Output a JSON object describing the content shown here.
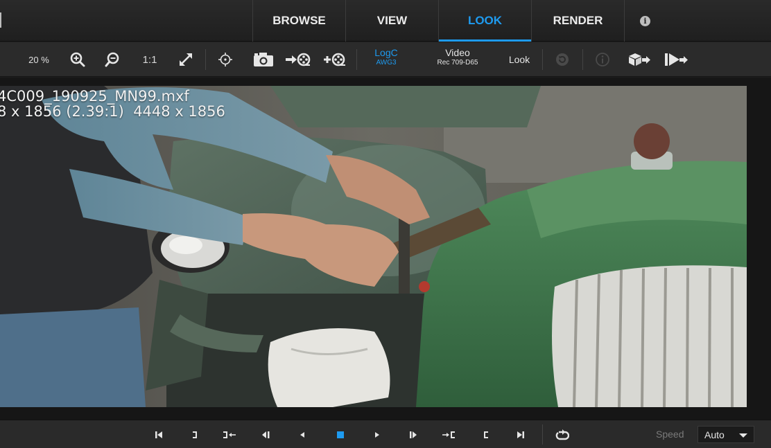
{
  "tabs": [
    {
      "label": "BROWSE",
      "active": false
    },
    {
      "label": "VIEW",
      "active": false
    },
    {
      "label": "LOOK",
      "active": true
    },
    {
      "label": "RENDER",
      "active": false
    }
  ],
  "info_tab": {
    "icon": "info-icon",
    "glyph": "i"
  },
  "toolbar": {
    "zoom_percent": "20 %",
    "one_to_one": "1:1",
    "input_colorspace": {
      "main": "LogC",
      "sub": "AWG3"
    },
    "output_colorspace": {
      "main": "Video",
      "sub": "Rec 709-D65"
    },
    "look_label": "Look",
    "icons": [
      "zoom-in-icon",
      "zoom-out-icon",
      "fit-expand-icon",
      "crosshair-icon",
      "camera-icon",
      "reel-import-icon",
      "reel-add-icon",
      "reset-look-icon",
      "info-icon",
      "export-box-icon",
      "export-cdl-icon"
    ]
  },
  "viewer": {
    "filename": "4C009_190925_MN99.mxf",
    "resolution": "8 x 1856 (2.39:1)  4448 x 1856"
  },
  "transport": {
    "icons": [
      "go-to-start-icon",
      "mark-out-icon",
      "go-to-out-icon",
      "step-back-icon",
      "play-reverse-icon",
      "stop-icon",
      "play-forward-icon",
      "step-forward-icon",
      "go-to-in-icon",
      "mark-in-icon",
      "go-to-end-icon",
      "loop-icon"
    ],
    "speed_label": "Speed",
    "speed_value": "Auto"
  },
  "colors": {
    "accent": "#1e9bf0",
    "background": "#1e1e1e",
    "toolbar": "#2b2b2b"
  }
}
